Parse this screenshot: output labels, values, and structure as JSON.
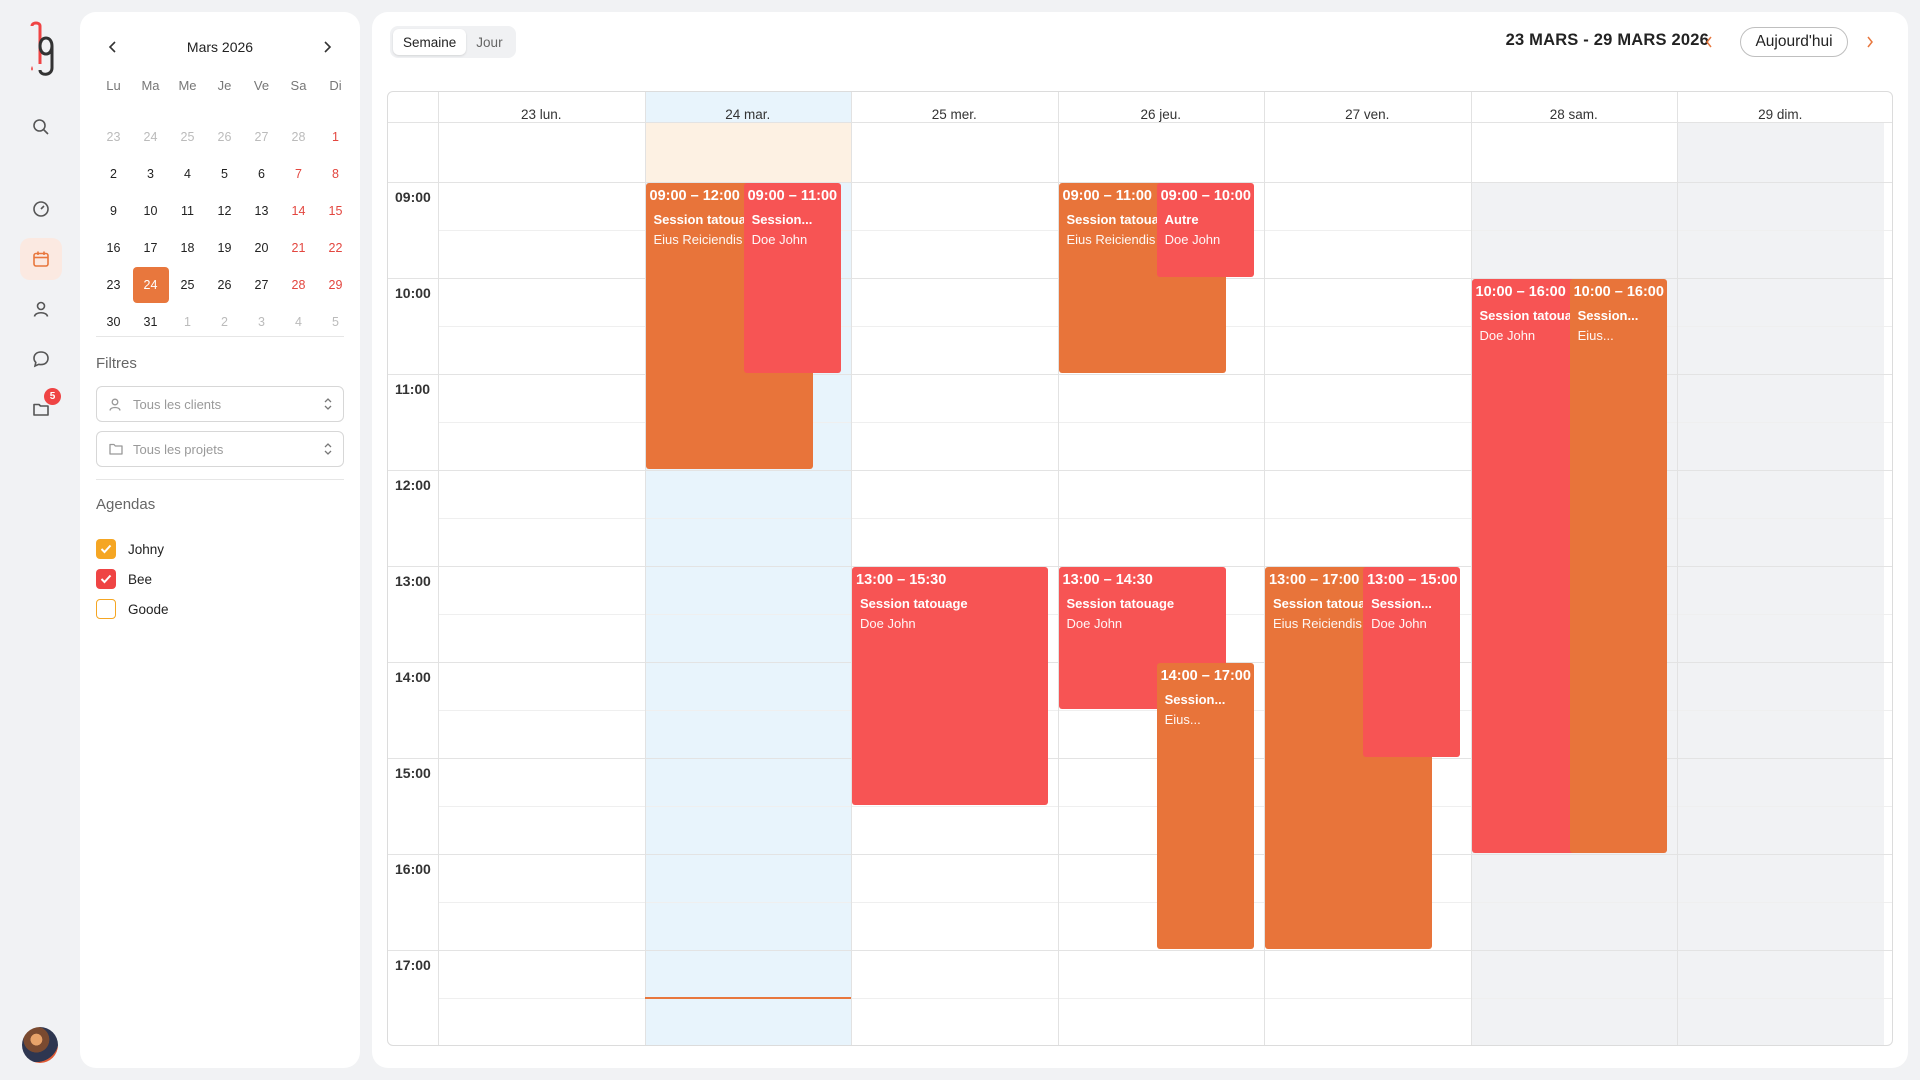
{
  "rail": {
    "icons": [
      "app-logo",
      "search-icon",
      "dashboard-icon",
      "calendar-icon",
      "user-icon",
      "chat-icon",
      "folder-icon"
    ],
    "badge": "5"
  },
  "mini_calendar": {
    "title": "Mars 2026",
    "dow": [
      "Lu",
      "Ma",
      "Me",
      "Je",
      "Ve",
      "Sa",
      "Di"
    ],
    "weeks": [
      [
        "23",
        "24",
        "25",
        "26",
        "27",
        "28",
        "1"
      ],
      [
        "2",
        "3",
        "4",
        "5",
        "6",
        "7",
        "8"
      ],
      [
        "9",
        "10",
        "11",
        "12",
        "13",
        "14",
        "15"
      ],
      [
        "16",
        "17",
        "18",
        "19",
        "20",
        "21",
        "22"
      ],
      [
        "23",
        "24",
        "25",
        "26",
        "27",
        "28",
        "29"
      ],
      [
        "30",
        "31",
        "1",
        "2",
        "3",
        "4",
        "5"
      ]
    ]
  },
  "filters": {
    "heading": "Filtres",
    "clients_placeholder": "Tous les clients",
    "projects_placeholder": "Tous les projets"
  },
  "agendas": {
    "heading": "Agendas",
    "items": [
      {
        "label": "Johny",
        "checked": true,
        "color": "#f5a623"
      },
      {
        "label": "Bee",
        "checked": true,
        "color": "#ef4444"
      },
      {
        "label": "Goode",
        "checked": false,
        "color": "#f5a623"
      }
    ]
  },
  "toolbar": {
    "view_week": "Semaine",
    "view_day": "Jour",
    "range": "23 MARS - 29 MARS 2026",
    "today": "Aujourd'hui"
  },
  "calendar": {
    "days": [
      "23 lun.",
      "24 mar.",
      "25 mer.",
      "26 jeu.",
      "27 ven.",
      "28 sam.",
      "29 dim."
    ],
    "hours": [
      "09:00",
      "10:00",
      "11:00",
      "12:00",
      "13:00",
      "14:00",
      "15:00",
      "16:00",
      "17:00"
    ],
    "events": [
      {
        "day": 1,
        "start": 9,
        "end": 12,
        "lane": "left",
        "color": "orange",
        "time": "09:00 – 12:00",
        "title": "Session tatouage",
        "client": "Eius Reiciendis"
      },
      {
        "day": 1,
        "start": 9,
        "end": 11,
        "lane": "right",
        "color": "red",
        "time": "09:00 – 11:00",
        "title": "Session...",
        "client": "Doe John"
      },
      {
        "day": 2,
        "start": 13,
        "end": 15.5,
        "lane": "full",
        "color": "red",
        "time": "13:00 – 15:30",
        "title": "Session tatouage",
        "client": "Doe John"
      },
      {
        "day": 3,
        "start": 9,
        "end": 11,
        "lane": "left",
        "color": "orange",
        "time": "09:00 – 11:00",
        "title": "Session tatouage",
        "client": "Eius Reiciendis"
      },
      {
        "day": 3,
        "start": 9,
        "end": 10,
        "lane": "right",
        "color": "red",
        "time": "09:00 – 10:00",
        "title": "Autre",
        "client": "Doe John"
      },
      {
        "day": 3,
        "start": 13,
        "end": 14.5,
        "lane": "left",
        "color": "red",
        "time": "13:00 – 14:30",
        "title": "Session tatouage",
        "client": "Doe John"
      },
      {
        "day": 3,
        "start": 14,
        "end": 17,
        "lane": "right",
        "color": "orange",
        "time": "14:00 – 17:00",
        "title": "Session...",
        "client": "Eius..."
      },
      {
        "day": 4,
        "start": 13,
        "end": 17,
        "lane": "left",
        "color": "orange",
        "time": "13:00 – 17:00",
        "title": "Session tatouage",
        "client": "Eius Reiciendis"
      },
      {
        "day": 4,
        "start": 13,
        "end": 15,
        "lane": "right",
        "color": "red",
        "time": "13:00 – 15:00",
        "title": "Session...",
        "client": "Doe John"
      },
      {
        "day": 5,
        "start": 10,
        "end": 16,
        "lane": "left",
        "color": "red",
        "time": "10:00 – 16:00",
        "title": "Session tatouage",
        "client": "Doe John"
      },
      {
        "day": 5,
        "start": 10,
        "end": 16,
        "lane": "right-solid",
        "color": "orange",
        "time": "10:00 – 16:00",
        "title": "Session...",
        "client": "Eius..."
      }
    ]
  }
}
